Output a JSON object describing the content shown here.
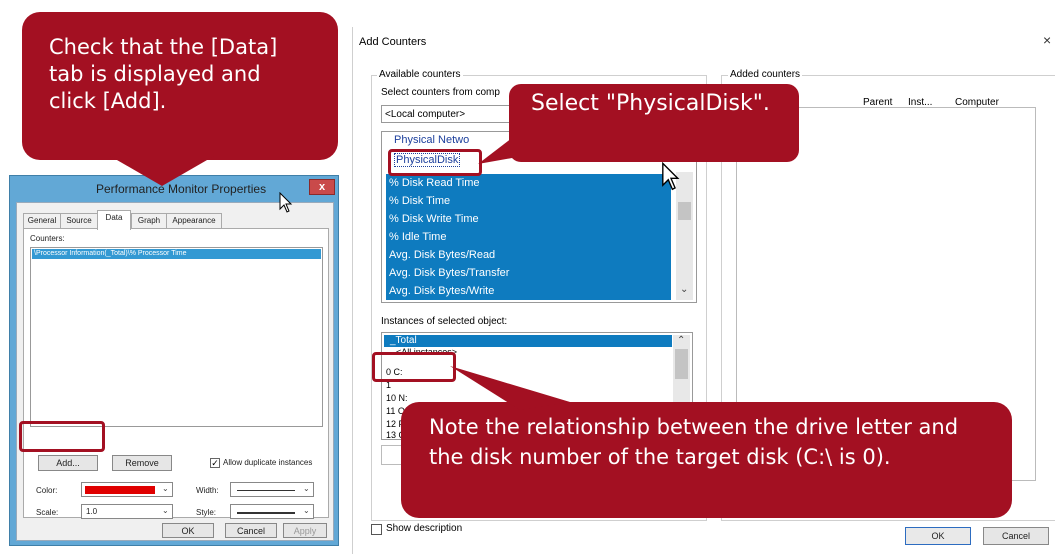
{
  "pmp": {
    "title": "Performance Monitor Properties",
    "close": "x",
    "tabs": [
      "General",
      "Source",
      "Data",
      "Graph",
      "Appearance"
    ],
    "counters_label": "Counters:",
    "counter_item": "\\Processor Information(_Total)\\% Processor Time",
    "add_button": "Add...",
    "remove_button": "Remove",
    "allow_duplicates": "Allow duplicate instances",
    "color_label": "Color:",
    "width_label": "Width:",
    "scale_label": "Scale:",
    "scale_value": "1.0",
    "style_label": "Style:",
    "ok": "OK",
    "cancel": "Cancel",
    "apply": "Apply"
  },
  "add_counters": {
    "title": "Add Counters",
    "close": "×",
    "available_label": "Available counters",
    "select_from": "Select counters from comp",
    "computer_value": "<Local computer>",
    "partial_object": "Physical Netwo",
    "selected_object": "PhysicalDisk",
    "counters": [
      "% Disk Read Time",
      "% Disk Time",
      "% Disk Write Time",
      "% Idle Time",
      "Avg. Disk Bytes/Read",
      "Avg. Disk Bytes/Transfer",
      "Avg. Disk Bytes/Write"
    ],
    "instances_label": "Instances of selected object:",
    "instances": [
      "_Total",
      "<All instances>",
      "0 C:",
      "1",
      "10 N:",
      "11 O",
      "12 P",
      "13 Q"
    ],
    "added_label": "Added counters",
    "col_parent": "Parent",
    "col_inst": "Inst...",
    "col_computer": "Computer",
    "show_description": "Show description",
    "ok": "OK",
    "cancel": "Cancel"
  },
  "callouts": {
    "data_tab": "Check that the [Data] tab is displayed and click [Add].",
    "physicaldisk": "Select \"PhysicalDisk\".",
    "note": "Note the relationship between the drive letter and the disk number of the target disk (C:\\ is 0)."
  },
  "colors": {
    "accent": "#a31022",
    "selection": "#0e7bbf",
    "window_frame": "#62a8d6",
    "color_swatch": "#e00000"
  }
}
